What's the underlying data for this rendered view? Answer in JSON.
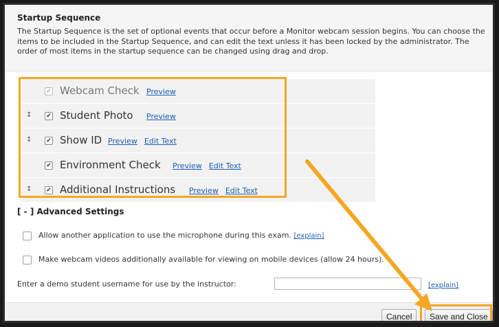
{
  "dialog": {
    "title": "Startup Sequence",
    "description": "The Startup Sequence is the set of optional events that occur before a Monitor webcam session begins. You can choose the items to be included in the Startup Sequence, and can edit the text unless it has been locked by the administrator.  The order of most items in the startup sequence can be changed using drag and drop."
  },
  "sequence": {
    "items": [
      {
        "label": "Webcam Check",
        "checked": true,
        "locked": true,
        "draggable": false,
        "preview": "Preview",
        "edit": ""
      },
      {
        "label": "Student Photo",
        "checked": true,
        "locked": false,
        "draggable": true,
        "preview": "Preview",
        "edit": ""
      },
      {
        "label": "Show ID",
        "checked": true,
        "locked": false,
        "draggable": true,
        "preview": "Preview",
        "edit": "Edit Text"
      },
      {
        "label": "Environment Check",
        "checked": true,
        "locked": false,
        "draggable": false,
        "preview": "Preview",
        "edit": "Edit Text"
      },
      {
        "label": "Additional Instructions",
        "checked": true,
        "locked": false,
        "draggable": true,
        "preview": "Preview",
        "edit": "Edit Text"
      }
    ]
  },
  "advanced": {
    "title": "[ - ] Advanced Settings",
    "microphone_label": "Allow another application to use the microphone during this exam.",
    "microphone_checked": false,
    "microphone_explain": "[explain]",
    "mobile_label": "Make webcam videos additionally available for viewing on mobile devices (allow 24 hours).",
    "mobile_checked": false,
    "demo_label": "Enter a demo student username for use by the instructor:",
    "demo_value": "",
    "demo_explain": "[explain]"
  },
  "footer": {
    "cancel_label": "Cancel",
    "save_label": "Save and Close"
  },
  "colors": {
    "highlight": "#f5a623",
    "link": "#1a5fb4"
  }
}
